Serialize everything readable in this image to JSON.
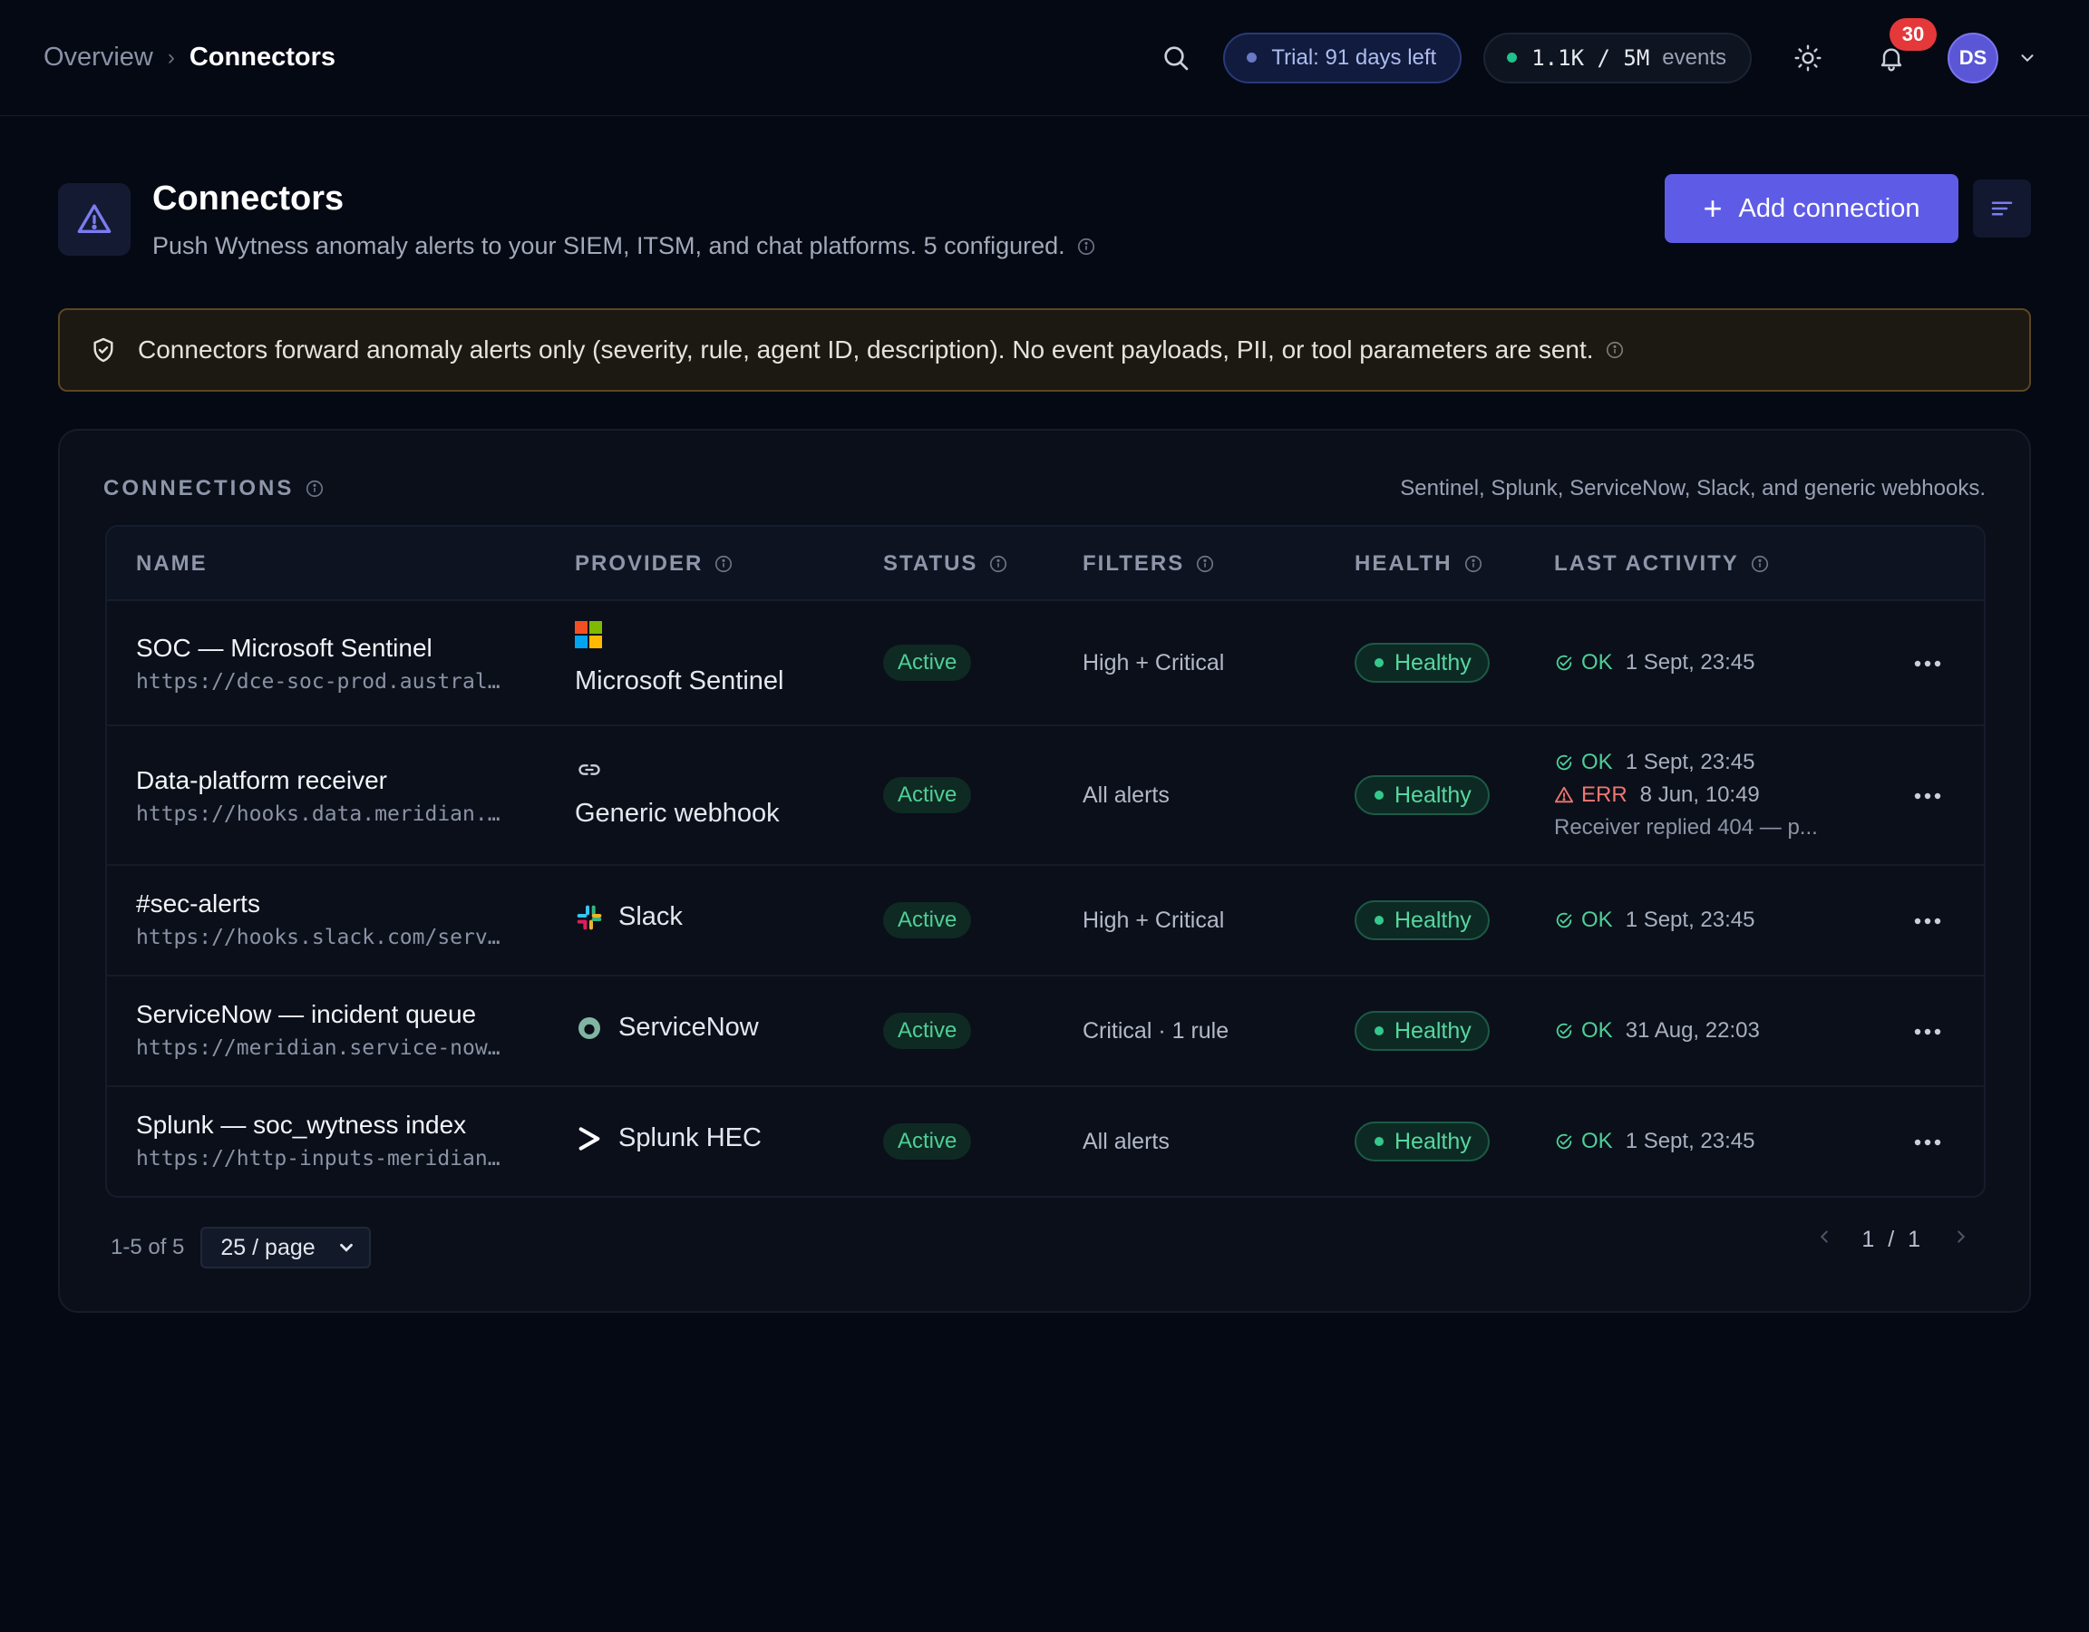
{
  "breadcrumb": {
    "parent": "Overview",
    "separator": "›",
    "current": "Connectors"
  },
  "topbar": {
    "trial_label": "Trial: 91 days left",
    "events_count": "1.1K / 5M",
    "events_unit": "events",
    "notifications_count": "30",
    "avatar_initials": "DS"
  },
  "header": {
    "title": "Connectors",
    "subtitle": "Push Wytness anomaly alerts to your SIEM, ITSM, and chat platforms. 5 configured.",
    "add_button": "Add connection",
    "add_button_icon": "+"
  },
  "notice": {
    "text": "Connectors forward anomaly alerts only (severity, rule, agent ID, description). No event payloads, PII, or tool parameters are sent."
  },
  "connections": {
    "title": "CONNECTIONS",
    "hint": "Sentinel, Splunk, ServiceNow, Slack, and generic webhooks.",
    "columns": {
      "name": "NAME",
      "provider": "PROVIDER",
      "status": "STATUS",
      "filters": "FILTERS",
      "health": "HEALTH",
      "last_activity": "LAST ACTIVITY"
    },
    "rows": [
      {
        "name": "SOC — Microsoft Sentinel",
        "url": "https://dce-soc-prod.austral…",
        "provider": "Microsoft Sentinel",
        "provider_icon": "microsoft-logo",
        "status": "Active",
        "filters": "High + Critical",
        "health": "Healthy",
        "activity": [
          {
            "result": "OK",
            "time": "1 Sept, 23:45"
          }
        ]
      },
      {
        "name": "Data-platform receiver",
        "url": "https://hooks.data.meridian.…",
        "provider": "Generic webhook",
        "provider_icon": "link-icon",
        "status": "Active",
        "filters": "All alerts",
        "health": "Healthy",
        "activity": [
          {
            "result": "OK",
            "time": "1 Sept, 23:45"
          },
          {
            "result": "ERR",
            "time": "8 Jun, 10:49"
          }
        ],
        "activity_message": "Receiver replied 404 — p..."
      },
      {
        "name": "#sec-alerts",
        "url": "https://hooks.slack.com/serv…",
        "provider": "Slack",
        "provider_icon": "slack-logo",
        "status": "Active",
        "filters": "High + Critical",
        "health": "Healthy",
        "activity": [
          {
            "result": "OK",
            "time": "1 Sept, 23:45"
          }
        ]
      },
      {
        "name": "ServiceNow — incident queue",
        "url": "https://meridian.service-now…",
        "provider": "ServiceNow",
        "provider_icon": "servicenow-logo",
        "status": "Active",
        "filters": "Critical · 1 rule",
        "health": "Healthy",
        "activity": [
          {
            "result": "OK",
            "time": "31 Aug, 22:03"
          }
        ]
      },
      {
        "name": "Splunk — soc_wytness index",
        "url": "https://http-inputs-meridian…",
        "provider": "Splunk HEC",
        "provider_icon": "splunk-logo",
        "status": "Active",
        "filters": "All alerts",
        "health": "Healthy",
        "activity": [
          {
            "result": "OK",
            "time": "1 Sept, 23:45"
          }
        ]
      }
    ]
  },
  "pagination": {
    "range": "1-5 of 5",
    "page_size": "25 / page",
    "current": "1",
    "separator": "/",
    "total": "1"
  },
  "colors": {
    "accent": "#5e5ce6",
    "success": "#4ecf98",
    "error": "#f07670",
    "notice_border": "#5b4622",
    "badge_red": "#e5383b"
  }
}
